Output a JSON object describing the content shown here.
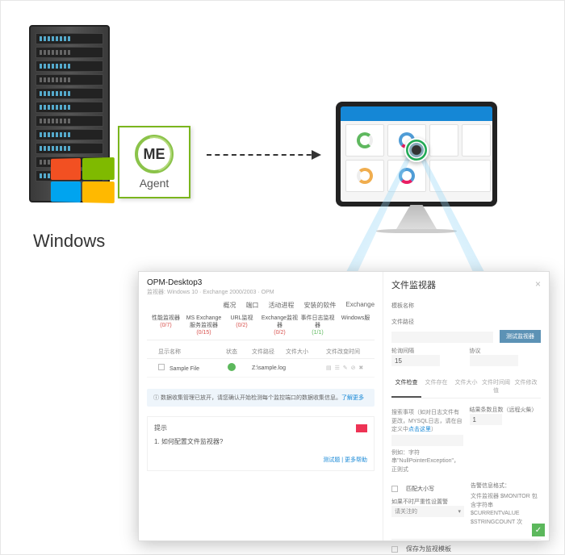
{
  "diagram": {
    "agent_logo_text": "ME",
    "agent_label": "Agent",
    "os_label": "Windows"
  },
  "app": {
    "title": "OPM-Desktop3",
    "subtitle": "监视器: Windows 10 · Exchange 2000/2003 · OPM",
    "top_tabs": [
      "概况",
      "端口",
      "活动进程",
      "安装的软件",
      "Exchange"
    ],
    "header_tabs": [
      {
        "label": "性能监视器",
        "count": "(0/7)",
        "cls": "r"
      },
      {
        "label": "MS Exchange服务监视器",
        "count": "(0/15)",
        "cls": "r"
      },
      {
        "label": "URL监视",
        "count": "(0/2)",
        "cls": "r"
      },
      {
        "label": "Exchange监视器",
        "count": "(0/2)",
        "cls": "r"
      },
      {
        "label": "事件日志监视器",
        "count": "(1/1)",
        "cls": "g"
      },
      {
        "label": "Windows服",
        "count": "",
        "cls": ""
      }
    ],
    "table": {
      "cols": [
        "显示名称",
        "状态",
        "文件路径",
        "文件大小",
        "文件改变时间"
      ],
      "row": {
        "name": "Sample File",
        "path": "Z:\\sample.log"
      }
    },
    "info": {
      "text": "数据收集管理已放开，请您确认开始检测每个监控端口的数据收集信息。",
      "link": "了解更多"
    },
    "tips": {
      "header": "提示",
      "q": "1. 如何配置文件监视器?",
      "links": "测试题 | 更多帮助"
    }
  },
  "side": {
    "title": "文件监视器",
    "f_name": "模板名称",
    "f_path": "文件路径",
    "btn_test": "测试监视器",
    "f_poll": "轮询间隔",
    "poll_val": "15",
    "f_proto": "协议",
    "subtabs": [
      "文件检查",
      "文件存在",
      "文件大小",
      "文件时间阈值",
      "文件修改"
    ],
    "desc1": "搜索事项（如对日志文件有更改，MYSQL日志，请在自定义中",
    "desc1_link": "点击这里",
    "desc1_tail": "）",
    "desc2": "例如：字符串\"NullPointerException\"，正则式",
    "res_label": "结果条数且数（远程火柴）",
    "res_val": "1",
    "chk_case": "匹配大小写",
    "alert_label": "告警信息格式：",
    "alert_val": "文件监视器 $MONITOR 包含字符串 $CURRENTVALUE $STRINGCOUNT 次",
    "sev_label": "如果不时严重性设置警",
    "sev_sel": "请关注的",
    "save": "保存为监视模板"
  }
}
